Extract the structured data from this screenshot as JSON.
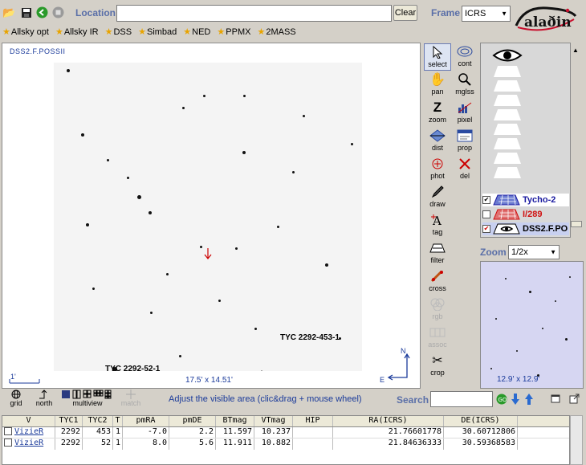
{
  "toolbar": {
    "location_label": "Location",
    "location_value": "",
    "clear_label": "Clear",
    "frame_label": "Frame",
    "frame_value": "ICRS",
    "logo_text": "aladin"
  },
  "bookmarks": [
    "Allsky opt",
    "Allsky IR",
    "DSS",
    "Simbad",
    "NED",
    "PPMX",
    "2MASS"
  ],
  "viewer": {
    "survey": "DSS2.F.POSSII",
    "fov": "17.5' x 14.51'",
    "scale": "1'",
    "objects": [
      "TYC 2292-453-1",
      "TYC 2292-52-1"
    ],
    "compass_n": "N",
    "compass_e": "E"
  },
  "tools": [
    "select",
    "cont",
    "pan",
    "mglss",
    "zoom",
    "pixel",
    "dist",
    "prop",
    "phot",
    "del",
    "draw",
    "tag",
    "filter",
    "cross",
    "rgb",
    "assoc",
    "crop"
  ],
  "layers": [
    {
      "name": "Tycho-2",
      "checked": true,
      "color": "#1a1aa0"
    },
    {
      "name": "I/289",
      "checked": false,
      "color": "#d01010"
    },
    {
      "name": "DSS2.F.PO",
      "checked": true,
      "color": "#000000"
    }
  ],
  "zoom": {
    "label": "Zoom",
    "value": "1/2x",
    "overview_fov": "12.9' x 12.9'"
  },
  "bottom": {
    "tools": [
      "grid",
      "north",
      "multiview",
      "match"
    ],
    "hint": "Adjust the visible area (clic&drag + mouse wheel)",
    "search_label": "Search",
    "search_value": ""
  },
  "table": {
    "columns": [
      "V",
      "TYC1",
      "TYC2",
      "T",
      "pmRA",
      "pmDE",
      "BTmag",
      "VTmag",
      "HIP",
      "RA(ICRS)",
      "DE(ICRS)"
    ],
    "rows": [
      [
        "VizieR",
        "2292",
        "453",
        "1",
        "-7.0",
        "2.2",
        "11.597",
        "10.237",
        "",
        "21.76601778",
        "30.60712806"
      ],
      [
        "VizieR",
        "2292",
        "52",
        "1",
        "8.0",
        "5.6",
        "11.911",
        "10.882",
        "",
        "21.84636333",
        "30.59368583"
      ]
    ]
  }
}
